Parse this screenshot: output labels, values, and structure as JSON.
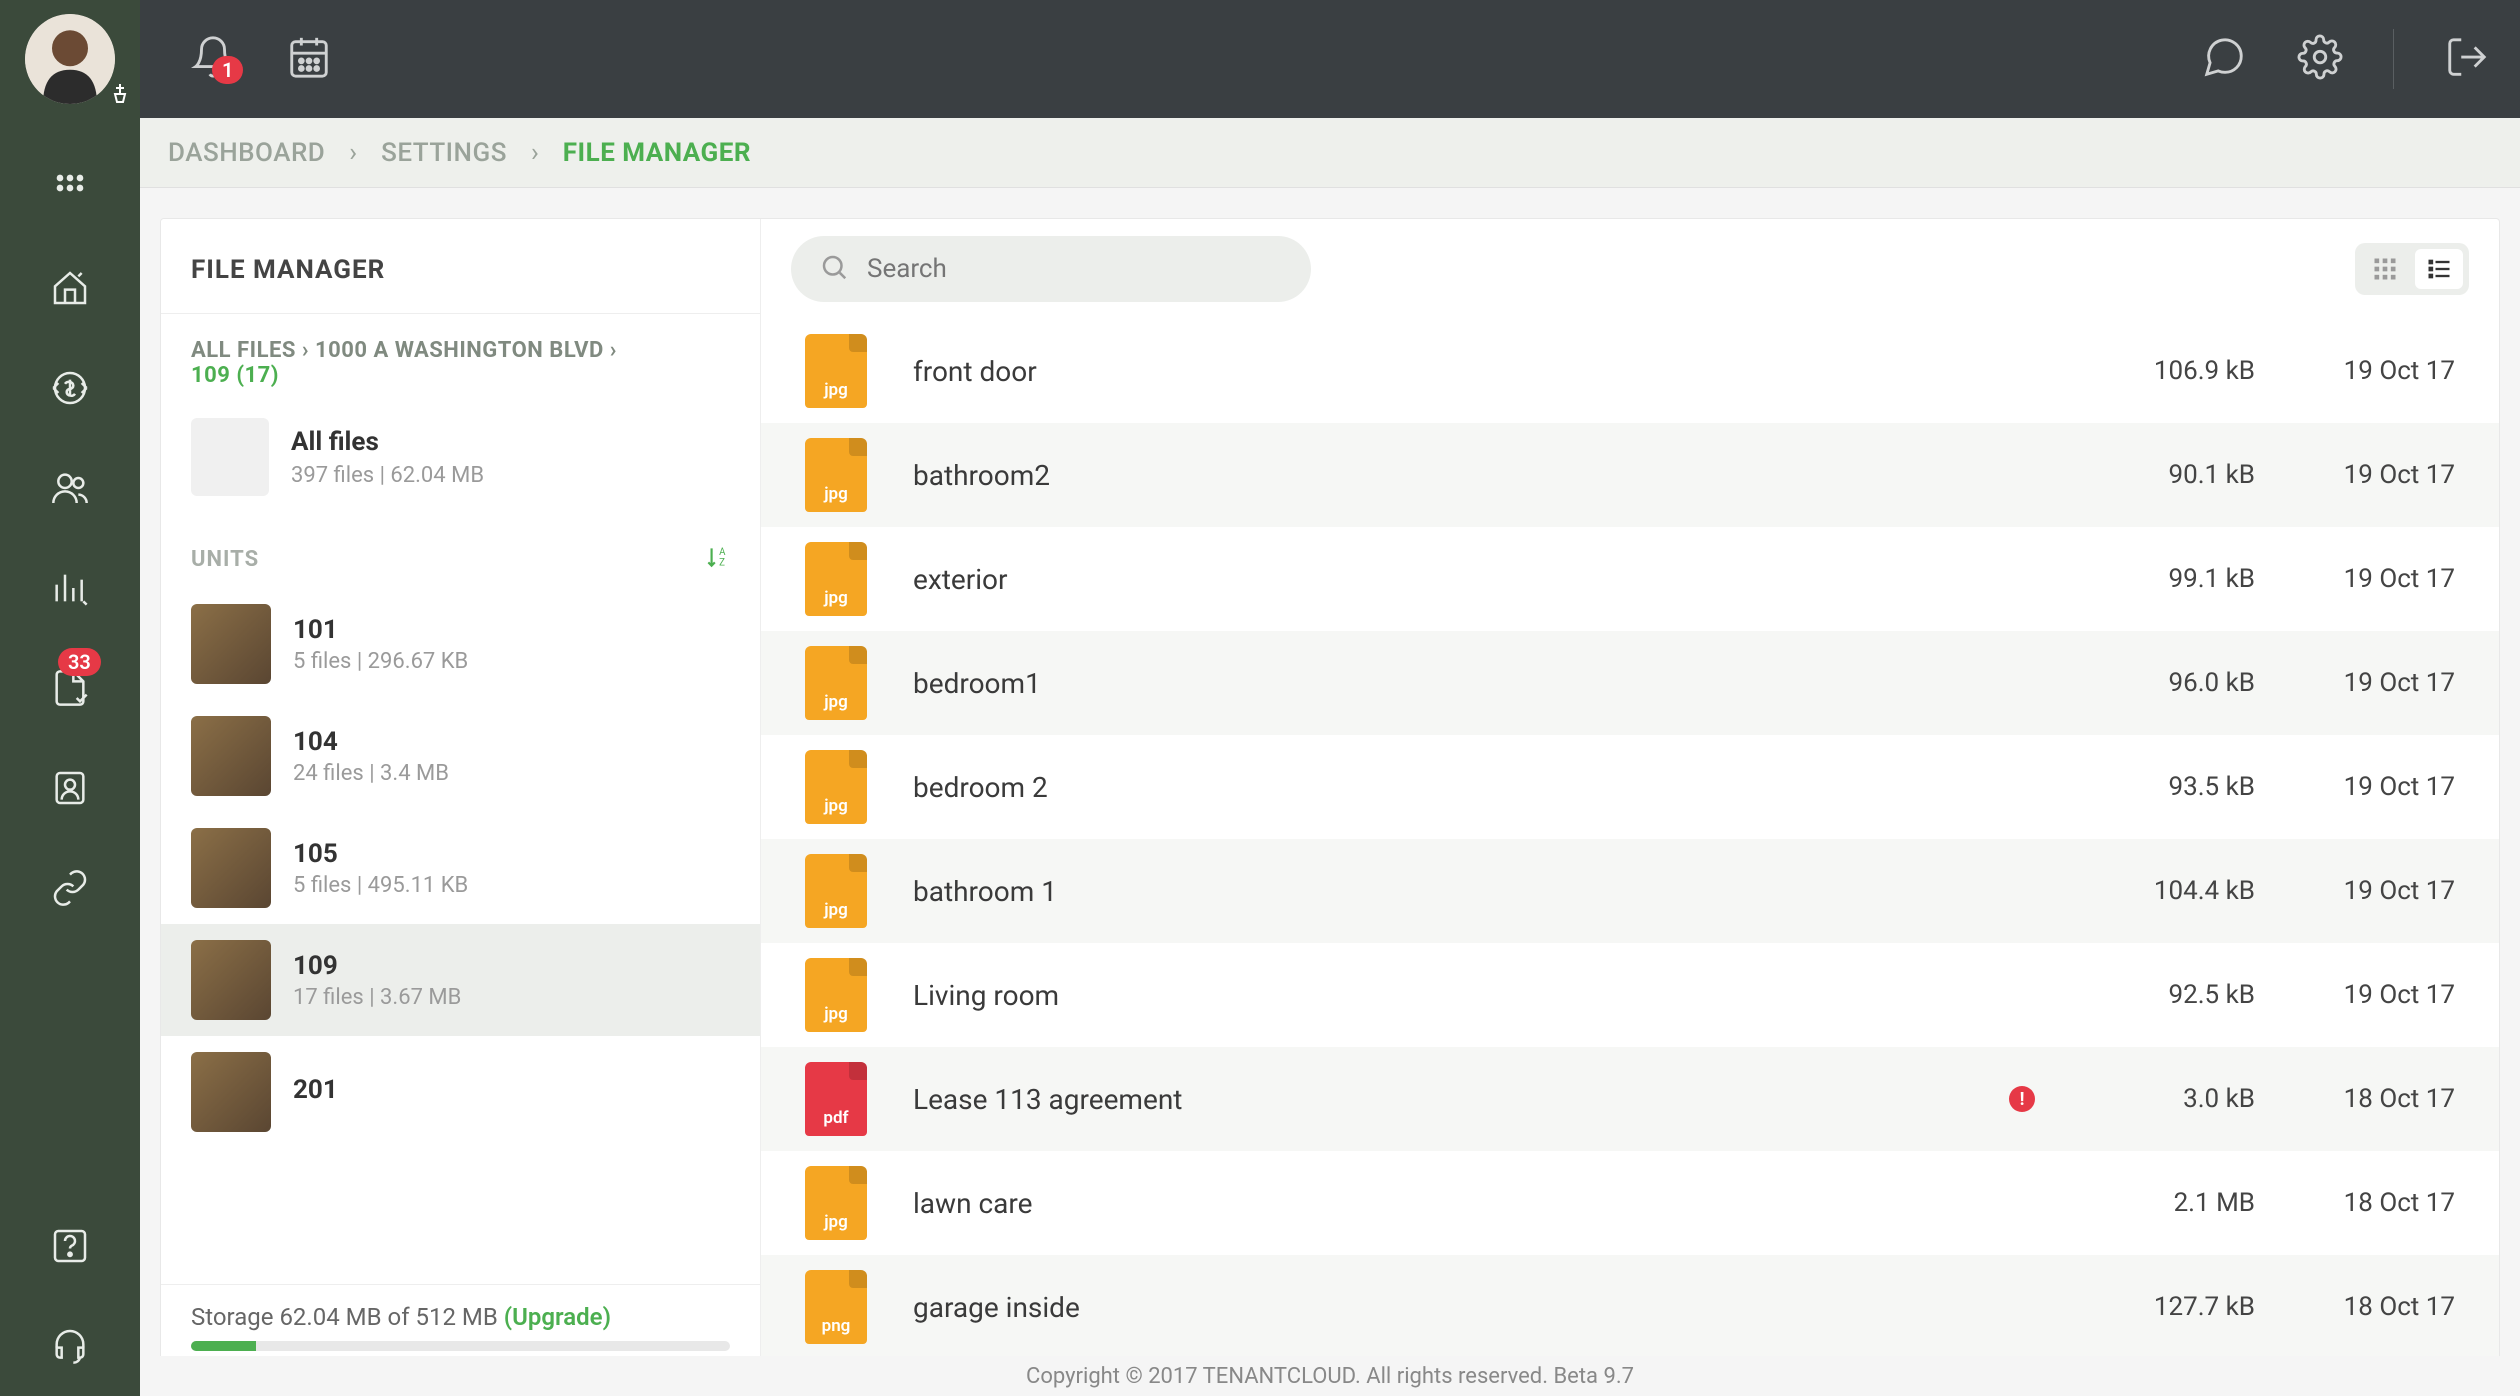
{
  "topbar": {
    "notification_badge": "1"
  },
  "breadcrumb": {
    "items": [
      "DASHBOARD",
      "SETTINGS",
      "FILE MANAGER"
    ]
  },
  "leftrail": {
    "doc_badge": "33"
  },
  "sidepanel": {
    "title": "FILE MANAGER",
    "path_crumb": {
      "root": "ALL FILES",
      "mid": "1000 A WASHINGTON BLVD",
      "current": "109 (17)"
    },
    "allfiles": {
      "label": "All files",
      "meta": "397 files | 62.04 MB"
    },
    "units_label": "UNITS",
    "units": [
      {
        "name": "101",
        "meta": "5 files | 296.67 KB",
        "active": false
      },
      {
        "name": "104",
        "meta": "24 files | 3.4 MB",
        "active": false
      },
      {
        "name": "105",
        "meta": "5 files | 495.11 KB",
        "active": false
      },
      {
        "name": "109",
        "meta": "17 files | 3.67 MB",
        "active": true
      },
      {
        "name": "201",
        "meta": "",
        "active": false
      }
    ],
    "storage": {
      "prefix": "Storage ",
      "used": "62.04 MB",
      "of": " of ",
      "total": "512 MB ",
      "upgrade": "(Upgrade)",
      "percent": 12
    }
  },
  "search": {
    "placeholder": "Search"
  },
  "files": [
    {
      "name": "front door",
      "ext": "jpg",
      "size": "106.9 kB",
      "date": "19 Oct 17",
      "warn": false
    },
    {
      "name": "bathroom2",
      "ext": "jpg",
      "size": "90.1 kB",
      "date": "19 Oct 17",
      "warn": false
    },
    {
      "name": "exterior",
      "ext": "jpg",
      "size": "99.1 kB",
      "date": "19 Oct 17",
      "warn": false
    },
    {
      "name": "bedroom1",
      "ext": "jpg",
      "size": "96.0 kB",
      "date": "19 Oct 17",
      "warn": false
    },
    {
      "name": "bedroom 2",
      "ext": "jpg",
      "size": "93.5 kB",
      "date": "19 Oct 17",
      "warn": false
    },
    {
      "name": "bathroom 1",
      "ext": "jpg",
      "size": "104.4 kB",
      "date": "19 Oct 17",
      "warn": false
    },
    {
      "name": "Living room",
      "ext": "jpg",
      "size": "92.5 kB",
      "date": "19 Oct 17",
      "warn": false
    },
    {
      "name": "Lease 113 agreement",
      "ext": "pdf",
      "size": "3.0 kB",
      "date": "18 Oct 17",
      "warn": true
    },
    {
      "name": "lawn care",
      "ext": "jpg",
      "size": "2.1 MB",
      "date": "18 Oct 17",
      "warn": false
    },
    {
      "name": "garage inside",
      "ext": "png",
      "size": "127.7 kB",
      "date": "18 Oct 17",
      "warn": false
    }
  ],
  "footer": "Copyright © 2017 TENANTCLOUD. All rights reserved. Beta 9.7"
}
